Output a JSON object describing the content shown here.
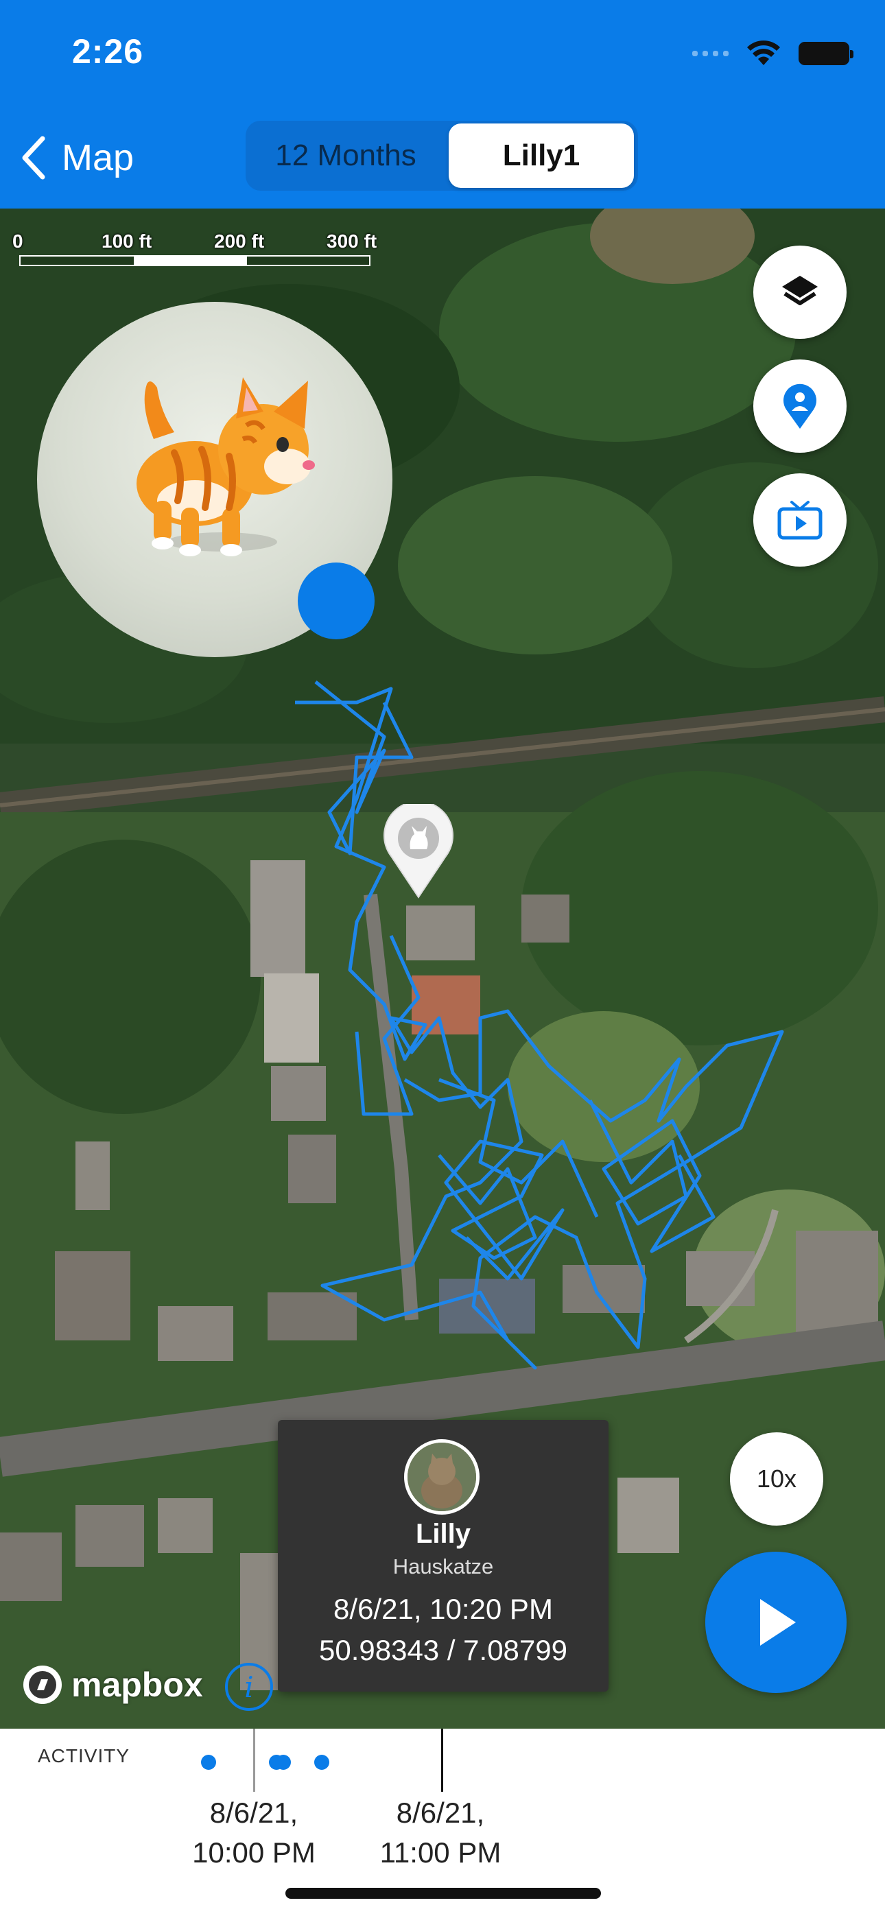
{
  "status_bar": {
    "time": "2:26"
  },
  "nav": {
    "back_label": "Map",
    "segments": [
      {
        "label": "12 Months",
        "selected": false
      },
      {
        "label": "Lilly1",
        "selected": true
      }
    ]
  },
  "map": {
    "scale_labels": [
      "0",
      "100 ft",
      "200 ft",
      "300 ft"
    ],
    "buttons": [
      "layers-icon",
      "location-pin-icon",
      "tv-icon"
    ],
    "attribution": "mapbox",
    "info_symbol": "i",
    "speed_label": "10x"
  },
  "info_card": {
    "name": "Lilly",
    "kind": "Hauskatze",
    "datetime": "8/6/21, 10:20 PM",
    "coordinates": "50.98343 / 7.08799"
  },
  "timeline": {
    "activity_label": "ACTIVITY",
    "ticks": [
      {
        "line1": "8/6/21,",
        "line2": "10:00 PM"
      },
      {
        "line1": "8/6/21,",
        "line2": "11:00 PM"
      }
    ]
  },
  "colors": {
    "accent": "#0a7ce8",
    "card": "#333333",
    "track": "#1e86ea"
  }
}
